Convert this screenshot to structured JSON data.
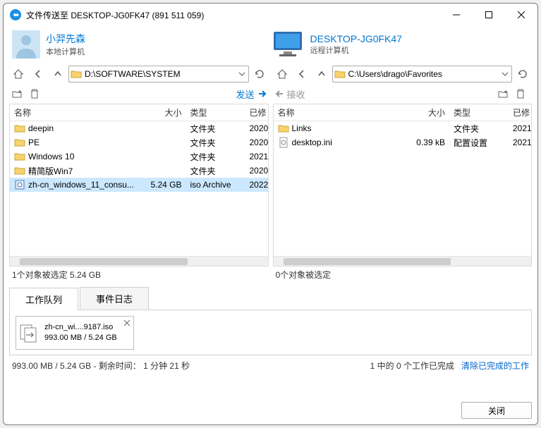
{
  "window": {
    "title": "文件传送至 DESKTOP-JG0FK47 (891 511 059)"
  },
  "local": {
    "name": "小羿先森",
    "sub": "本地计算机",
    "path": "D:\\SOFTWARE\\SYSTEM",
    "status": "1个对象被选定  5.24 GB"
  },
  "remote": {
    "name": "DESKTOP-JG0FK47",
    "sub": "远程计算机",
    "path": "C:\\Users\\drago\\Favorites",
    "status": "0个对象被选定"
  },
  "actions": {
    "send": "发送",
    "receive": "接收"
  },
  "cols": {
    "name": "名称",
    "size": "大小",
    "type": "类型",
    "mod": "已修"
  },
  "localFiles": [
    {
      "name": "deepin",
      "size": "",
      "type": "文件夹",
      "mod": "2020",
      "icon": "folder"
    },
    {
      "name": "PE",
      "size": "",
      "type": "文件夹",
      "mod": "2020",
      "icon": "folder"
    },
    {
      "name": "Windows 10",
      "size": "",
      "type": "文件夹",
      "mod": "2021",
      "icon": "folder"
    },
    {
      "name": "精简版Win7",
      "size": "",
      "type": "文件夹",
      "mod": "2020",
      "icon": "folder"
    },
    {
      "name": "zh-cn_windows_11_consu...",
      "size": "5.24 GB",
      "type": "iso Archive",
      "mod": "2022",
      "icon": "iso",
      "selected": true
    }
  ],
  "remoteFiles": [
    {
      "name": "Links",
      "size": "",
      "type": "文件夹",
      "mod": "2021",
      "icon": "folder"
    },
    {
      "name": "desktop.ini",
      "size": "0.39 kB",
      "type": "配置设置",
      "mod": "2021",
      "icon": "ini"
    }
  ],
  "tabs": {
    "queue": "工作队列",
    "log": "事件日志"
  },
  "queue": {
    "file": "zh-cn_wi....9187.iso",
    "progress": "993.00 MB / 5.24 GB"
  },
  "footer": {
    "left": "993.00 MB / 5.24 GB - 剩余时间：  1 分钟 21 秒",
    "right": "1 中的 0 个工作已完成",
    "link": "清除已完成的工作"
  },
  "buttons": {
    "close": "关闭"
  }
}
